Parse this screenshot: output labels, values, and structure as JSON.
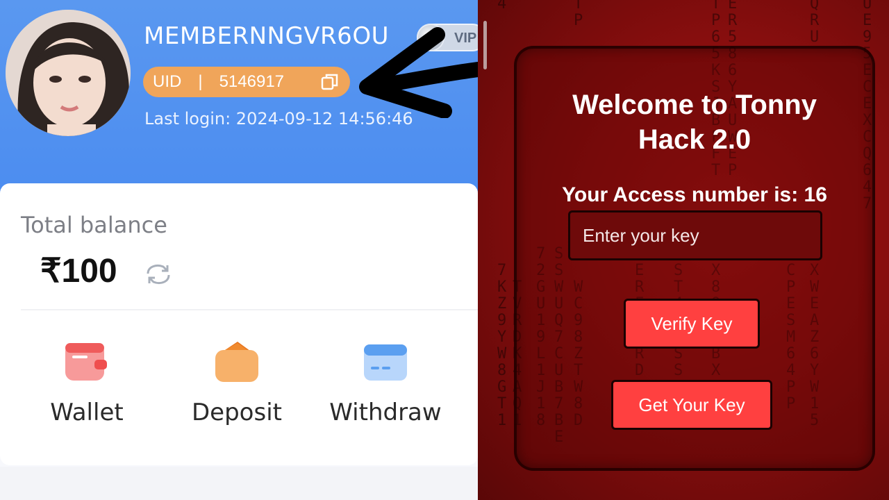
{
  "profile": {
    "username": "MEMBERNNGVR6OU",
    "vip_label": "VIP",
    "uid_label": "UID",
    "uid_separator": "|",
    "uid_value": "5146917",
    "last_login": "Last login: 2024-09-12 14:56:46"
  },
  "balance": {
    "label": "Total balance",
    "amount": "₹100"
  },
  "actions": [
    {
      "label": "Wallet",
      "icon": "wallet-icon",
      "color": "#f36a6a"
    },
    {
      "label": "Deposit",
      "icon": "deposit-icon",
      "color": "#f39a3c"
    },
    {
      "label": "Withdraw",
      "icon": "withdraw-icon",
      "color": "#5b9ff0"
    }
  ],
  "hack_panel": {
    "title": "Welcome to Tonny Hack 2.0",
    "access_text": "Your Access number is: 16",
    "key_placeholder": "Enter your key",
    "verify_button": "Verify Key",
    "get_key_button": "Get Your Key",
    "button_color": "#ff4040"
  },
  "colors": {
    "header_blue": "#4b8cf0",
    "uid_orange": "#f0a55a",
    "panel_red": "#a51414"
  }
}
